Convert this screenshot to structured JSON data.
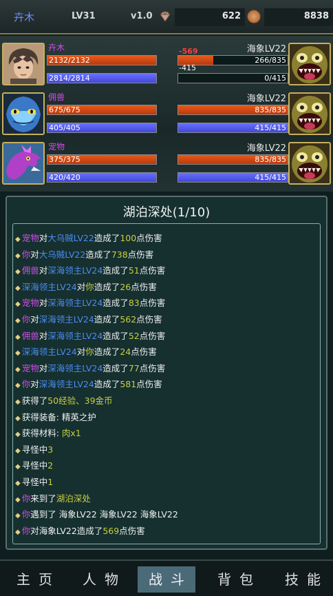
{
  "topbar": {
    "player_name": "卉木",
    "level": "LV31",
    "version": "v1.0",
    "gems": "622",
    "gold": "8838",
    "gem_icon": "diamond-icon",
    "coin_icon": "coin-icon"
  },
  "party": [
    {
      "name": "卉木",
      "hp_text": "2132/2132",
      "hp_fraction": 1.0,
      "mp_text": "2814/2814",
      "mp_fraction": 1.0,
      "portrait": "hero-portrait"
    },
    {
      "name": "佣兽",
      "hp_text": "675/675",
      "hp_fraction": 1.0,
      "mp_text": "405/405",
      "mp_fraction": 1.0,
      "portrait": "fish-creature-portrait"
    },
    {
      "name": "宠物",
      "hp_text": "375/375",
      "hp_fraction": 1.0,
      "mp_text": "420/420",
      "mp_fraction": 1.0,
      "portrait": "dragon-portrait"
    }
  ],
  "enemies": [
    {
      "name": "海象LV22",
      "hp_text": "266/835",
      "hp_fraction": 0.319,
      "mp_text": "0/415",
      "mp_fraction": 0.0,
      "damage_popup": "-569",
      "mp_popup": "-415",
      "portrait": "sea-monster-portrait"
    },
    {
      "name": "海象LV22",
      "hp_text": "835/835",
      "hp_fraction": 1.0,
      "mp_text": "415/415",
      "mp_fraction": 1.0,
      "portrait": "sea-monster-portrait"
    },
    {
      "name": "海象LV22",
      "hp_text": "835/835",
      "hp_fraction": 1.0,
      "mp_text": "415/415",
      "mp_fraction": 1.0,
      "portrait": "sea-monster-portrait"
    }
  ],
  "log_panel": {
    "title": "湖泊深处(1/10)",
    "lines": [
      [
        [
          "宠物",
          "pet"
        ],
        [
          "对",
          ""
        ],
        [
          "大乌贼LV22",
          "enemy"
        ],
        [
          "造成了",
          ""
        ],
        [
          "100",
          "num"
        ],
        [
          "点伤害",
          ""
        ]
      ],
      [
        [
          "你",
          "you"
        ],
        [
          "对",
          ""
        ],
        [
          "大乌贼LV22",
          "enemy"
        ],
        [
          "造成了",
          ""
        ],
        [
          "738",
          "num"
        ],
        [
          "点伤害",
          ""
        ]
      ],
      [
        [
          "佣兽",
          "ally"
        ],
        [
          "对",
          ""
        ],
        [
          "深海领主LV24",
          "enemy"
        ],
        [
          "造成了",
          ""
        ],
        [
          "51",
          "num"
        ],
        [
          "点伤害",
          ""
        ]
      ],
      [
        [
          "深海领主LV24",
          "enemy"
        ],
        [
          "对",
          ""
        ],
        [
          "你",
          "num"
        ],
        [
          "造成了",
          ""
        ],
        [
          "26",
          "num"
        ],
        [
          "点伤害",
          ""
        ]
      ],
      [
        [
          "宠物",
          "pet"
        ],
        [
          "对",
          ""
        ],
        [
          "深海领主LV24",
          "enemy"
        ],
        [
          "造成了",
          ""
        ],
        [
          "83",
          "num"
        ],
        [
          "点伤害",
          ""
        ]
      ],
      [
        [
          "你",
          "you"
        ],
        [
          "对",
          ""
        ],
        [
          "深海领主LV24",
          "enemy"
        ],
        [
          "造成了",
          ""
        ],
        [
          "562",
          "num"
        ],
        [
          "点伤害",
          ""
        ]
      ],
      [
        [
          "佣兽",
          "ally"
        ],
        [
          "对",
          ""
        ],
        [
          "深海领主LV24",
          "enemy"
        ],
        [
          "造成了",
          ""
        ],
        [
          "52",
          "num"
        ],
        [
          "点伤害",
          ""
        ]
      ],
      [
        [
          "深海领主LV24",
          "enemy"
        ],
        [
          "对",
          ""
        ],
        [
          "你",
          "num"
        ],
        [
          "造成了",
          ""
        ],
        [
          "24",
          "num"
        ],
        [
          "点伤害",
          ""
        ]
      ],
      [
        [
          "宠物",
          "pet"
        ],
        [
          "对",
          ""
        ],
        [
          "深海领主LV24",
          "enemy"
        ],
        [
          "造成了",
          ""
        ],
        [
          "77",
          "num"
        ],
        [
          "点伤害",
          ""
        ]
      ],
      [
        [
          "你",
          "you"
        ],
        [
          "对",
          ""
        ],
        [
          "深海领主LV24",
          "enemy"
        ],
        [
          "造成了",
          ""
        ],
        [
          "581",
          "num"
        ],
        [
          "点伤害",
          ""
        ]
      ],
      [
        [
          "获得了",
          ""
        ],
        [
          "50经验、39金币",
          "gold"
        ]
      ],
      [
        [
          "获得装备: 精英之护",
          ""
        ]
      ],
      [
        [
          "获得材料: ",
          ""
        ],
        [
          "肉x1",
          "gold"
        ]
      ],
      [
        [
          "寻怪中",
          ""
        ],
        [
          "3",
          "gold"
        ]
      ],
      [
        [
          "寻怪中",
          ""
        ],
        [
          "2",
          "gold"
        ]
      ],
      [
        [
          "寻怪中",
          ""
        ],
        [
          "1",
          "gold"
        ]
      ],
      [
        [
          "你",
          "you"
        ],
        [
          "来到了",
          ""
        ],
        [
          "湖泊深处",
          "gold"
        ]
      ],
      [
        [
          "你",
          "you"
        ],
        [
          "遇到了 海象LV22 海象LV22 海象LV22",
          ""
        ]
      ],
      [
        [
          "你",
          "you"
        ],
        [
          "对",
          ""
        ],
        [
          "海象LV22",
          ""
        ],
        [
          "造成了",
          ""
        ],
        [
          "569",
          "num"
        ],
        [
          "点伤害",
          ""
        ]
      ]
    ]
  },
  "nav": {
    "items": [
      "主页",
      "人物",
      "战斗",
      "背包",
      "技能"
    ],
    "active_index": 2
  }
}
